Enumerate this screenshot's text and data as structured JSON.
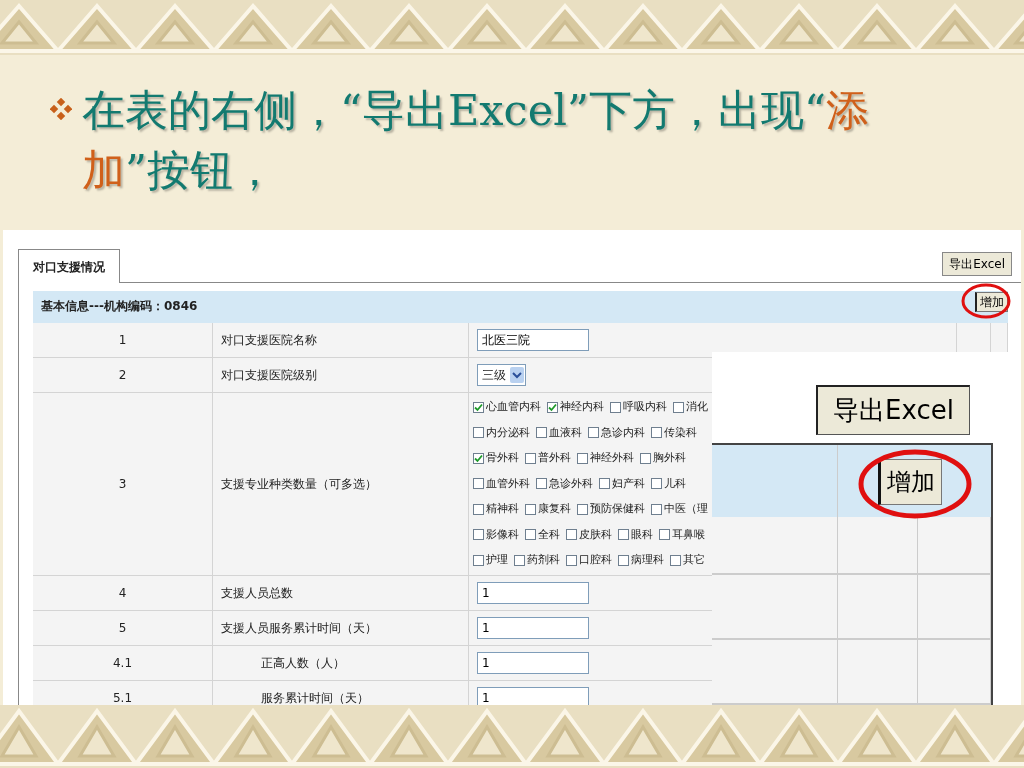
{
  "slide": {
    "title_parts": [
      {
        "text": "在表的右侧，“导出Excel”下方，出现“",
        "highlight": false
      },
      {
        "text": "添加",
        "highlight": true
      },
      {
        "text": "”按钮，",
        "highlight": false
      }
    ]
  },
  "app": {
    "tab": {
      "label": "对口支援情况",
      "selected": true
    },
    "export_button": "导出Excel",
    "section_title": "基本信息---机构编码：0846",
    "add_button": "增加",
    "rows": [
      {
        "number": "1",
        "label": "对口支援医院名称",
        "kind": "text",
        "value": "北医三院",
        "sub": false
      },
      {
        "number": "2",
        "label": "对口支援医院级别",
        "kind": "select",
        "value": "三级",
        "sub": false
      },
      {
        "number": "3",
        "label": "支援专业种类数量（可多选）",
        "kind": "checkboxes",
        "sub": false,
        "options": [
          [
            {
              "label": "心血管内科",
              "checked": true
            },
            {
              "label": "神经内科",
              "checked": true
            },
            {
              "label": "呼吸内科",
              "checked": false
            },
            {
              "label": "消化",
              "checked": false
            }
          ],
          [
            {
              "label": "内分泌科",
              "checked": false
            },
            {
              "label": "血液科",
              "checked": false
            },
            {
              "label": "急诊内科",
              "checked": false
            },
            {
              "label": "传染科",
              "checked": false
            }
          ],
          [
            {
              "label": "骨外科",
              "checked": true
            },
            {
              "label": "普外科",
              "checked": false
            },
            {
              "label": "神经外科",
              "checked": false
            },
            {
              "label": "胸外科",
              "checked": false
            }
          ],
          [
            {
              "label": "血管外科",
              "checked": false
            },
            {
              "label": "急诊外科",
              "checked": false
            },
            {
              "label": "妇产科",
              "checked": false
            },
            {
              "label": "儿科",
              "checked": false
            }
          ],
          [
            {
              "label": "精神科",
              "checked": false
            },
            {
              "label": "康复科",
              "checked": false
            },
            {
              "label": "预防保健科",
              "checked": false
            },
            {
              "label": "中医（理",
              "checked": false
            }
          ],
          [
            {
              "label": "影像科",
              "checked": false
            },
            {
              "label": "全科",
              "checked": false
            },
            {
              "label": "皮肤科",
              "checked": false
            },
            {
              "label": "眼科",
              "checked": false
            },
            {
              "label": "耳鼻喉",
              "checked": false
            }
          ],
          [
            {
              "label": "护理",
              "checked": false
            },
            {
              "label": "药剂科",
              "checked": false
            },
            {
              "label": "口腔科",
              "checked": false
            },
            {
              "label": "病理科",
              "checked": false
            },
            {
              "label": "其它",
              "checked": false
            }
          ]
        ]
      },
      {
        "number": "4",
        "label": "支援人员总数",
        "kind": "text",
        "value": "1",
        "sub": false
      },
      {
        "number": "5",
        "label": "支援人员服务累计时间（天）",
        "kind": "text",
        "value": "1",
        "sub": false
      },
      {
        "number": "4.1",
        "label": "正高人数（人）",
        "kind": "text",
        "value": "1",
        "sub": true
      },
      {
        "number": "5.1",
        "label": "服务累计时间（天）",
        "kind": "text",
        "value": "1",
        "sub": true
      }
    ]
  },
  "zoom_inset": {
    "export_button": "导出Excel",
    "add_button": "增加"
  }
}
